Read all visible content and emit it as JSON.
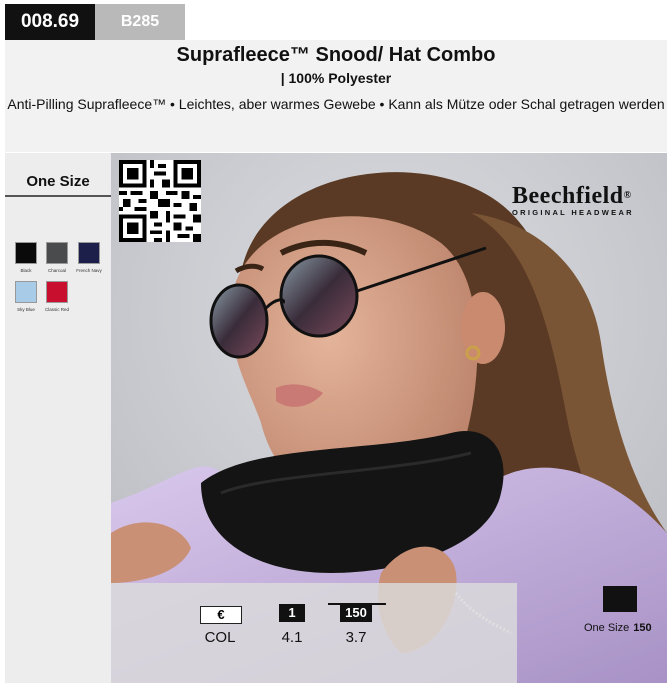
{
  "codes": {
    "main": "008.69",
    "sub": "B285"
  },
  "product": {
    "title": "Suprafleece™ Snood/ Hat Combo",
    "material": "| 100% Polyester",
    "description": "Anti-Pilling Suprafleece™ • Leichtes, aber warmes Gewebe • Kann als Mütze oder Schal getragen werden"
  },
  "size": {
    "label": "One Size"
  },
  "colors": [
    {
      "name": "Black",
      "hex": "#0a0a0a"
    },
    {
      "name": "Charcoal",
      "hex": "#4a4b4d"
    },
    {
      "name": "French Navy",
      "hex": "#1b1f4a"
    },
    {
      "name": "Sky Blue",
      "hex": "#a8cbe8"
    },
    {
      "name": "Classic Red",
      "hex": "#c8102e"
    }
  ],
  "brand": {
    "name": "Beechfield",
    "mark": "®",
    "tagline": "ORIGINAL HEADWEAR"
  },
  "pricing": {
    "currency_box": "€",
    "col_label": "COL",
    "tiers": [
      {
        "qty": "1",
        "price": "4.1"
      },
      {
        "qty": "150",
        "price": "3.7"
      }
    ]
  },
  "carton": {
    "size_label": "One Size",
    "qty": "150"
  }
}
